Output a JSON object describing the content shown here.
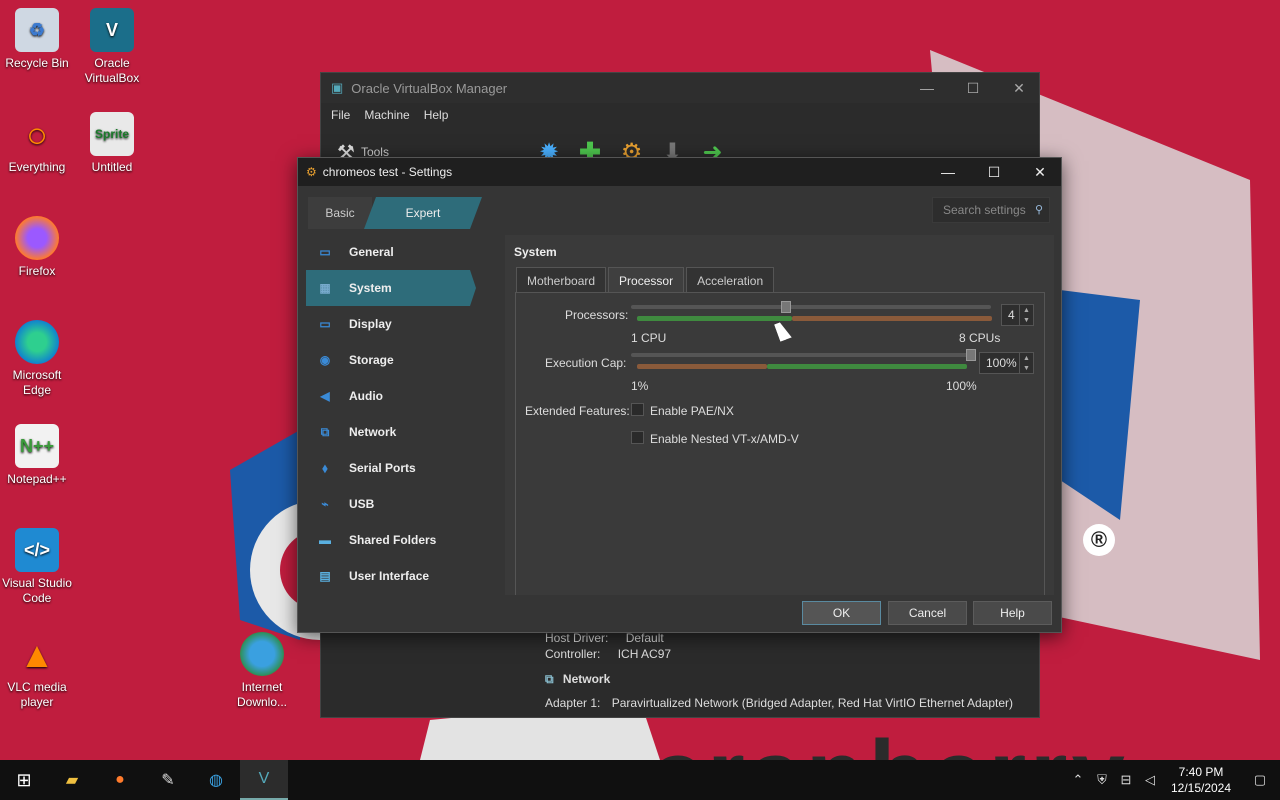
{
  "desktop": {
    "icons": [
      {
        "label": "Recycle Bin",
        "icon": "recycle-bin-icon"
      },
      {
        "label": "Oracle VirtualBox",
        "icon": "virtualbox-icon"
      },
      {
        "label": "Everything",
        "icon": "everything-search-icon"
      },
      {
        "label": "Untitled",
        "icon": "sprite-image-icon"
      },
      {
        "label": "Firefox",
        "icon": "firefox-icon"
      },
      {
        "label": "Microsoft Edge",
        "icon": "edge-icon"
      },
      {
        "label": "Notepad++",
        "icon": "notepad-plus-plus-icon"
      },
      {
        "label": "Visual Studio Code",
        "icon": "vscode-icon"
      },
      {
        "label": "VLC media player",
        "icon": "vlc-icon"
      },
      {
        "label": "Internet Downlo...",
        "icon": "internet-download-manager-icon"
      }
    ],
    "wallpaper_text": "cranberry",
    "registered_mark": "®",
    "colors": {
      "wallpaper": "#c01d3e",
      "accent": "#2e6c7a"
    }
  },
  "vbox_manager": {
    "title": "Oracle VirtualBox Manager",
    "menu": [
      "File",
      "Machine",
      "Help"
    ],
    "tools_label": "Tools",
    "details": {
      "host_driver_label": "Host Driver:",
      "host_driver_value": "Default",
      "controller_label": "Controller:",
      "controller_value": "ICH AC97",
      "network_heading": "Network",
      "adapter_label": "Adapter 1:",
      "adapter_value": "Paravirtualized Network (Bridged Adapter, Red Hat VirtIO Ethernet Adapter)"
    }
  },
  "settings_dialog": {
    "title": "chromeos test - Settings",
    "mode": {
      "basic": "Basic",
      "expert": "Expert"
    },
    "search_placeholder": "Search settings",
    "nav": [
      {
        "label": "General",
        "icon": "general-icon"
      },
      {
        "label": "System",
        "icon": "system-icon",
        "active": true
      },
      {
        "label": "Display",
        "icon": "display-icon"
      },
      {
        "label": "Storage",
        "icon": "storage-icon"
      },
      {
        "label": "Audio",
        "icon": "audio-icon"
      },
      {
        "label": "Network",
        "icon": "network-icon"
      },
      {
        "label": "Serial Ports",
        "icon": "serial-ports-icon"
      },
      {
        "label": "USB",
        "icon": "usb-icon"
      },
      {
        "label": "Shared Folders",
        "icon": "shared-folders-icon"
      },
      {
        "label": "User Interface",
        "icon": "user-interface-icon"
      }
    ],
    "section_title": "System",
    "tabs": [
      "Motherboard",
      "Processor",
      "Acceleration"
    ],
    "active_tab": "Processor",
    "processor": {
      "processors_label": "Processors:",
      "processors_value": "4",
      "processors_min": "1 CPU",
      "processors_max": "8 CPUs",
      "processors_fraction": 0.43,
      "cap_label": "Execution Cap:",
      "cap_value": "100%",
      "cap_min": "1%",
      "cap_max": "100%",
      "cap_fraction": 1.0,
      "extended_label": "Extended Features:",
      "pae": "Enable PAE/NX",
      "nested": "Enable Nested VT-x/AMD-V"
    },
    "buttons": {
      "ok": "OK",
      "cancel": "Cancel",
      "help": "Help"
    }
  },
  "taskbar": {
    "time": "7:40 PM",
    "date": "12/15/2024"
  }
}
